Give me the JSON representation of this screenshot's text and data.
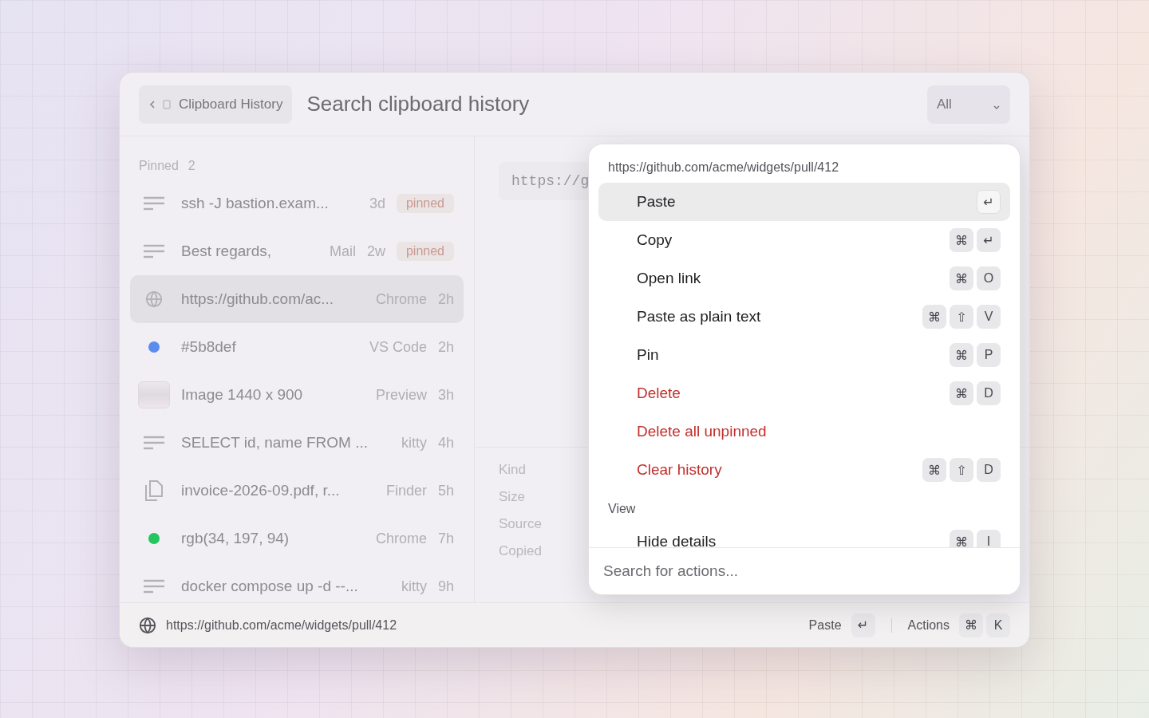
{
  "header": {
    "back_label": "Clipboard History",
    "title": "Search clipboard history",
    "filter": "All"
  },
  "list": {
    "section": {
      "label": "Pinned",
      "count": "2"
    },
    "items": [
      {
        "kind": "text",
        "title": "ssh -J bastion.exam...",
        "time": "3d",
        "badge": "pinned",
        "selected": false
      },
      {
        "kind": "text",
        "title": "Best regards,",
        "source": "Mail",
        "time": "2w",
        "badge": "pinned",
        "selected": false
      },
      {
        "kind": "link",
        "title": "https://github.com/ac...",
        "source": "Chrome",
        "time": "2h",
        "selected": true
      },
      {
        "kind": "color",
        "color": "#5b8def",
        "title": "#5b8def",
        "source": "VS Code",
        "time": "2h",
        "selected": false
      },
      {
        "kind": "image",
        "title": "Image 1440 x 900",
        "source": "Preview",
        "time": "3h",
        "selected": false
      },
      {
        "kind": "text",
        "title": "SELECT id, name FROM ...",
        "source": "kitty",
        "time": "4h",
        "selected": false
      },
      {
        "kind": "file",
        "title": "invoice-2026-09.pdf, r...",
        "source": "Finder",
        "time": "5h",
        "selected": false
      },
      {
        "kind": "color",
        "color": "#22c55e",
        "title": "rgb(34, 197, 94)",
        "source": "Chrome",
        "time": "7h",
        "selected": false
      },
      {
        "kind": "text",
        "title": "docker compose up -d --...",
        "source": "kitty",
        "time": "9h",
        "selected": false
      }
    ]
  },
  "detail": {
    "preview": "https://g",
    "metadata": [
      "Kind",
      "Size",
      "Source",
      "Copied"
    ]
  },
  "actions": {
    "title": "https://github.com/acme/widgets/pull/412",
    "groups": [
      {
        "items": [
          {
            "label": "Paste",
            "keys": [
              "↵"
            ],
            "destructive": false,
            "selected": true
          },
          {
            "label": "Copy",
            "keys": [
              "⌘",
              "↵"
            ],
            "destructive": false,
            "selected": false
          },
          {
            "label": "Open link",
            "keys": [
              "⌘",
              "O"
            ],
            "destructive": false,
            "selected": false
          },
          {
            "label": "Paste as plain text",
            "keys": [
              "⌘",
              "⇧",
              "V"
            ],
            "destructive": false,
            "selected": false
          },
          {
            "label": "Pin",
            "keys": [
              "⌘",
              "P"
            ],
            "destructive": false,
            "selected": false
          },
          {
            "label": "Delete",
            "keys": [
              "⌘",
              "D"
            ],
            "destructive": true,
            "selected": false
          },
          {
            "label": "Delete all unpinned",
            "destructive": true,
            "selected": false
          },
          {
            "label": "Clear history",
            "keys": [
              "⌘",
              "⇧",
              "D"
            ],
            "destructive": true,
            "selected": false
          }
        ]
      },
      {
        "heading": "View",
        "items": [
          {
            "label": "Hide details",
            "keys": [
              "⌘",
              "I"
            ],
            "destructive": false,
            "selected": false
          }
        ]
      }
    ],
    "search_placeholder": "Search for actions..."
  },
  "footer": {
    "url": "https://github.com/acme/widgets/pull/412",
    "primary": {
      "label": "Paste",
      "keys": [
        "↵"
      ]
    },
    "secondary": {
      "label": "Actions",
      "keys": [
        "⌘",
        "K"
      ]
    }
  }
}
